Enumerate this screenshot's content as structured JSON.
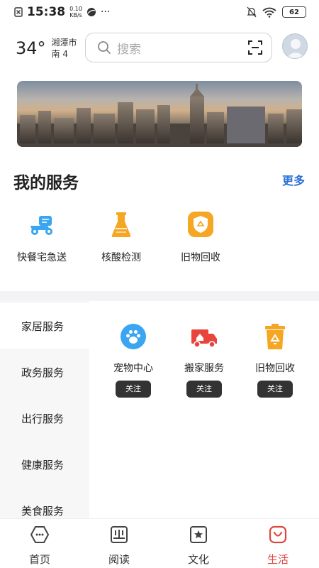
{
  "status_bar": {
    "time": "15:38",
    "net_speed_value": "0.10",
    "net_speed_unit": "KB/s",
    "more": "···",
    "battery": "62"
  },
  "header": {
    "temperature": "34°",
    "city": "湘潭市",
    "wind": "南 4",
    "search_placeholder": "搜索"
  },
  "my_services": {
    "title": "我的服务",
    "more_label": "更多",
    "items": [
      {
        "label": "快餐宅急送",
        "icon": "delivery-scooter-icon"
      },
      {
        "label": "核酸检测",
        "icon": "test-flask-icon"
      },
      {
        "label": "旧物回收",
        "icon": "recycle-shield-icon"
      }
    ]
  },
  "categories": {
    "items": [
      {
        "label": "家居服务",
        "active": true
      },
      {
        "label": "政务服务"
      },
      {
        "label": "出行服务"
      },
      {
        "label": "健康服务"
      },
      {
        "label": "美食服务"
      }
    ],
    "cards": [
      {
        "label": "宠物中心",
        "button": "关注",
        "icon": "paw-icon"
      },
      {
        "label": "搬家服务",
        "button": "关注",
        "icon": "moving-truck-icon"
      },
      {
        "label": "旧物回收",
        "button": "关注",
        "icon": "recycle-bin-icon"
      }
    ]
  },
  "bottom_nav": {
    "items": [
      {
        "label": "首页",
        "icon": "home-icon"
      },
      {
        "label": "阅读",
        "icon": "book-icon"
      },
      {
        "label": "文化",
        "icon": "culture-icon"
      },
      {
        "label": "生活",
        "icon": "life-icon",
        "active": true
      }
    ]
  },
  "colors": {
    "accent_blue": "#2a6fd6",
    "active_red": "#e0473f",
    "orange": "#f5a623"
  }
}
